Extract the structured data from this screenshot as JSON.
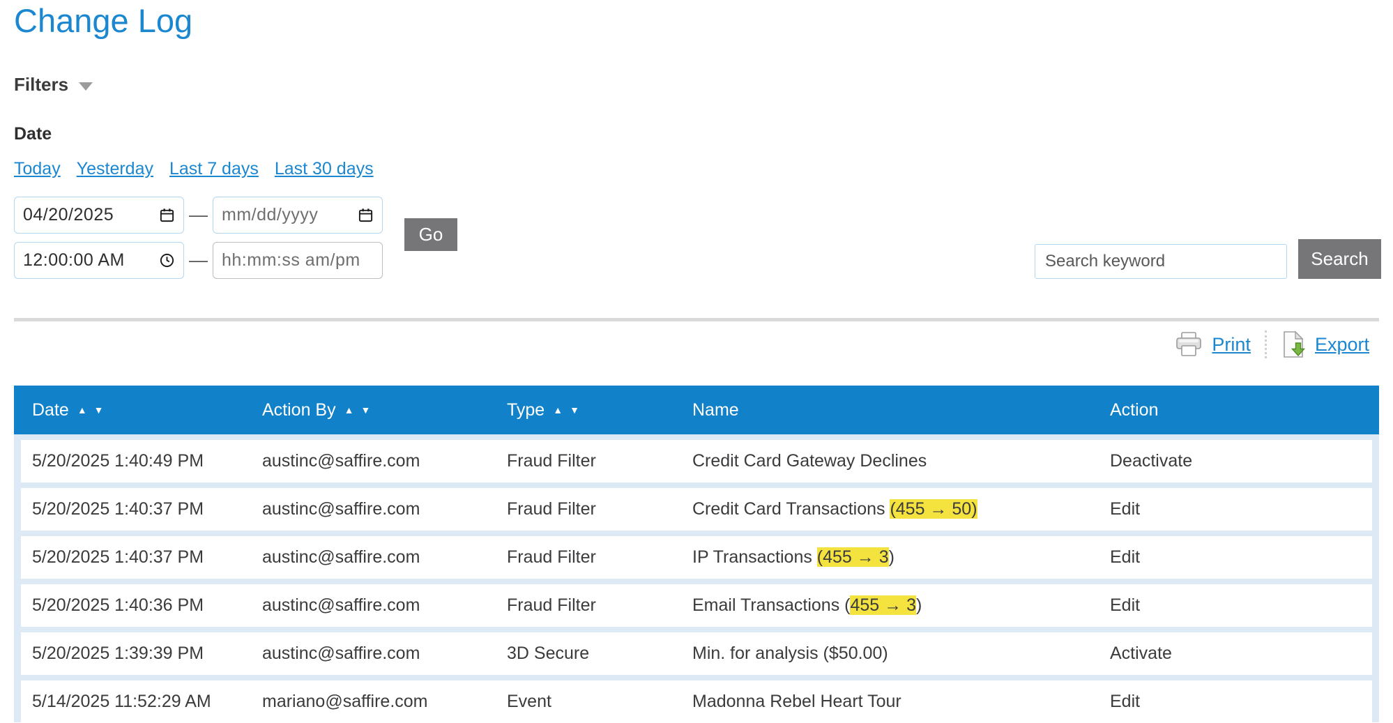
{
  "page": {
    "title": "Change Log"
  },
  "filters": {
    "label": "Filters",
    "date_label": "Date",
    "quick_links": [
      "Today",
      "Yesterday",
      "Last 7 days",
      "Last 30 days"
    ],
    "date_from": "04/20/2025",
    "date_to_placeholder": "mm/dd/yyyy",
    "time_from": "12:00:00 AM",
    "time_to_placeholder": "hh:mm:ss am/pm",
    "separator": "—",
    "go_label": "Go"
  },
  "search": {
    "placeholder": "Search keyword",
    "button_label": "Search"
  },
  "toolbar": {
    "print_label": "Print",
    "export_label": "Export"
  },
  "table": {
    "columns": [
      {
        "label": "Date",
        "sortable": true
      },
      {
        "label": "Action By",
        "sortable": true
      },
      {
        "label": "Type",
        "sortable": true
      },
      {
        "label": "Name",
        "sortable": false
      },
      {
        "label": "Action",
        "sortable": false
      }
    ],
    "rows": [
      {
        "date": "5/20/2025 1:40:49 PM",
        "action_by": "austinc@saffire.com",
        "type": "Fraud Filter",
        "name_prefix": "Credit Card Gateway Declines",
        "name_highlight": "",
        "name_suffix": "",
        "action": "Deactivate"
      },
      {
        "date": "5/20/2025 1:40:37 PM",
        "action_by": "austinc@saffire.com",
        "type": "Fraud Filter",
        "name_prefix": "Credit Card Transactions ",
        "name_highlight": "(455 → 50)",
        "name_suffix": "",
        "action": "Edit"
      },
      {
        "date": "5/20/2025 1:40:37 PM",
        "action_by": "austinc@saffire.com",
        "type": "Fraud Filter",
        "name_prefix": "IP Transactions ",
        "name_highlight": "(455 → 3",
        "name_suffix": ")",
        "action": "Edit"
      },
      {
        "date": "5/20/2025 1:40:36 PM",
        "action_by": "austinc@saffire.com",
        "type": "Fraud Filter",
        "name_prefix": "Email Transactions (",
        "name_highlight": "455 → 3",
        "name_suffix": ")",
        "action": "Edit"
      },
      {
        "date": "5/20/2025 1:39:39 PM",
        "action_by": "austinc@saffire.com",
        "type": "3D Secure",
        "name_prefix": "Min. for analysis ($50.00)",
        "name_highlight": "",
        "name_suffix": "",
        "action": "Activate"
      },
      {
        "date": "5/14/2025 11:52:29 AM",
        "action_by": "mariano@saffire.com",
        "type": "Event",
        "name_prefix": "Madonna Rebel Heart Tour",
        "name_highlight": "",
        "name_suffix": "",
        "action": "Edit"
      }
    ]
  },
  "colors": {
    "accent_blue": "#1b87d0",
    "table_header_blue": "#1182ca",
    "row_gap_blue": "#dde9f5",
    "highlight_yellow": "#f4e33f",
    "button_gray": "#767678"
  }
}
